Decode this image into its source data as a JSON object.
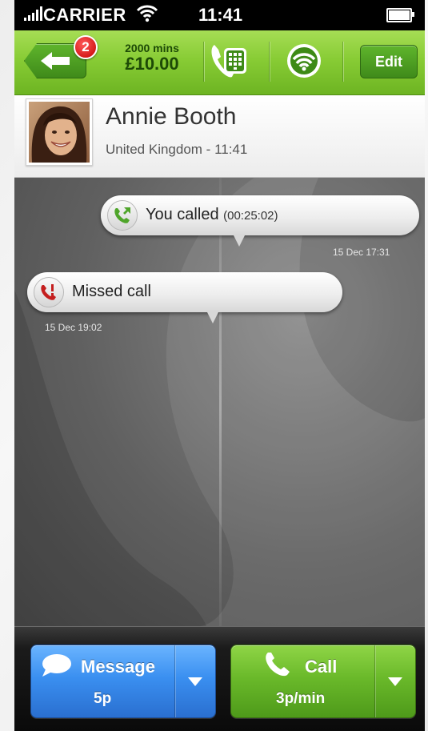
{
  "status_bar": {
    "carrier": "CARRIER",
    "time": "11:41"
  },
  "toolbar": {
    "back_badge_count": "2",
    "minutes": "2000 mins",
    "credit": "£10.00",
    "edit_label": "Edit"
  },
  "contact": {
    "name": "Annie Booth",
    "subtitle": "United Kingdom - 11:41"
  },
  "history": [
    {
      "type": "outgoing",
      "label": "You called",
      "duration": "(00:25:02)",
      "timestamp": "15 Dec 17:31",
      "icon": "outgoing-call-icon"
    },
    {
      "type": "missed",
      "label": "Missed call",
      "timestamp": "15 Dec 19:02",
      "icon": "missed-call-icon"
    }
  ],
  "actions": {
    "message": {
      "label": "Message",
      "rate": "5p",
      "icon": "speech-bubble-icon"
    },
    "call": {
      "label": "Call",
      "rate": "3p/min",
      "icon": "phone-handset-icon"
    }
  },
  "colors": {
    "toolbar_green": "#88cc35",
    "message_blue": "#3a8ff0",
    "call_green": "#6ab92a",
    "badge_red": "#d40000"
  }
}
